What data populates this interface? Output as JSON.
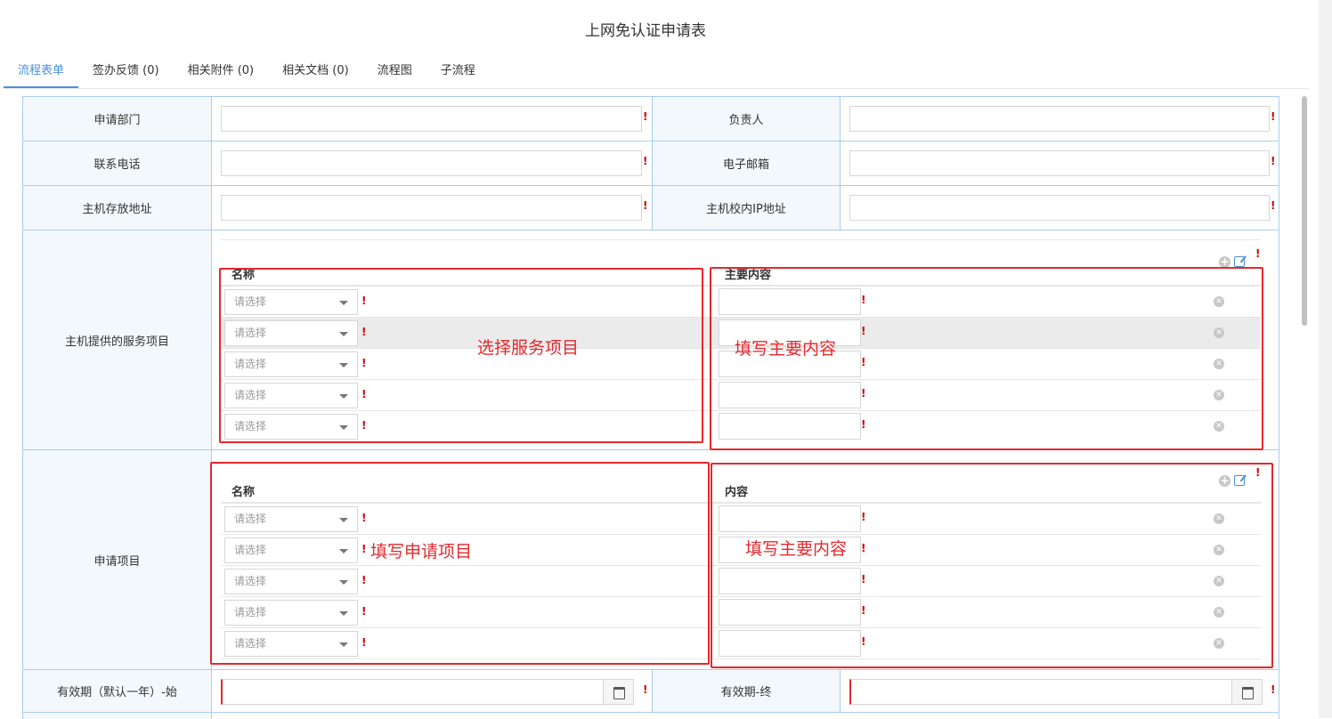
{
  "page": {
    "title": "上网免认证申请表"
  },
  "tabs": [
    {
      "label": "流程表单",
      "active": true
    },
    {
      "label": "签办反馈 (0)"
    },
    {
      "label": "相关附件 (0)"
    },
    {
      "label": "相关文档 (0)"
    },
    {
      "label": "流程图"
    },
    {
      "label": "子流程"
    }
  ],
  "form": {
    "dept_label": "申请部门",
    "owner_label": "负责人",
    "phone_label": "联系电话",
    "email_label": "电子邮箱",
    "host_addr_label": "主机存放地址",
    "host_ip_label": "主机校内IP地址",
    "services_label": "主机提供的服务项目",
    "apply_items_label": "申请项目",
    "valid_from_label": "有效期（默认一年）-始",
    "valid_to_label": "有效期-终",
    "required_mark": "!"
  },
  "services_table": {
    "col_name": "名称",
    "col_content": "主要内容",
    "select_placeholder": "请选择",
    "row_count": 5
  },
  "apply_table": {
    "col_name": "名称",
    "col_content": "内容",
    "select_placeholder": "请选择",
    "row_count": 5
  },
  "annotations": {
    "select_services": "选择服务项目",
    "fill_content_1": "填写主要内容",
    "fill_apply": "填写申请项目",
    "fill_content_2": "填写主要内容"
  },
  "colors": {
    "accent": "#4a90d9",
    "border": "#a9cdef",
    "label_bg": "#f3f8fd",
    "annotation": "#e5282d",
    "required": "#d40000"
  }
}
